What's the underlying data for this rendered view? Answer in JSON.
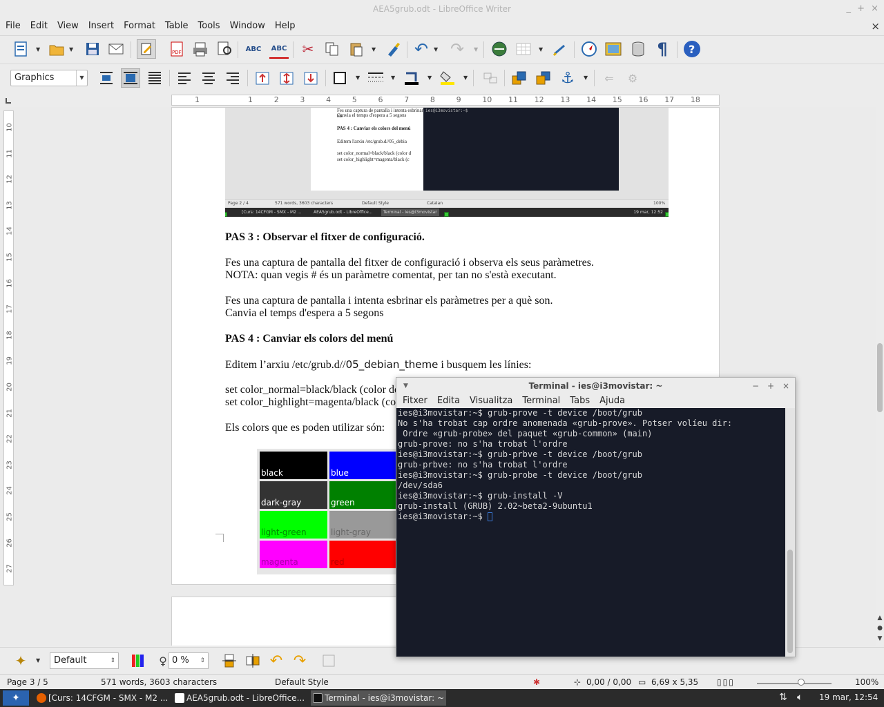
{
  "window": {
    "title": "AEA5grub.odt - LibreOffice Writer",
    "min": "_",
    "max": "+",
    "close": "×"
  },
  "menubar": {
    "items": [
      "File",
      "Edit",
      "View",
      "Insert",
      "Format",
      "Table",
      "Tools",
      "Window",
      "Help"
    ],
    "close_doc": "×"
  },
  "toolbar2": {
    "frame_style": "Graphics"
  },
  "ruler": {
    "h": [
      "1",
      "1",
      "2",
      "3",
      "4",
      "5",
      "6",
      "7",
      "8",
      "9",
      "10",
      "11",
      "12",
      "13",
      "14",
      "15",
      "16",
      "17",
      "18"
    ],
    "v": [
      "10",
      "11",
      "12",
      "13",
      "14",
      "15",
      "16",
      "17",
      "18",
      "19",
      "20",
      "21",
      "22",
      "23",
      "24",
      "25",
      "26",
      "27"
    ]
  },
  "embedded": {
    "doc_lines": [
      "Fes una captura de pantalla i intenta esbrinar els",
      "Canvia el temps d'espera a 5 segons",
      "PAS 4 : Canviar els colors del menú",
      "Editem l'arxiu /etc/grub.d//05_debia",
      "set color_normal=black/black (color d",
      "set color_highlight=magenta/black (c"
    ],
    "term_line": "ies@i3movistar:~$",
    "status": [
      "Page 2 / 4",
      "571 words, 3603 characters",
      "Default Style",
      "Catalan",
      "100%"
    ],
    "tasks": [
      "[Curs: 14CFGM - SMX - M2 ...",
      "AEA5grub.odt - LibreOffice...",
      "Terminal - ies@i3movistar"
    ],
    "clock": "19 mar, 12:52"
  },
  "document": {
    "h3": "PAS 3 : Observar el fitxer de configuració.",
    "p1a": "Fes una captura de pantalla del fitxer de configuració i observa els seus paràmetres.",
    "p1b": "NOTA: quan vegis # és un paràmetre comentat, per tan no s'està executant.",
    "p2a": "Fes una captura de pantalla i intenta esbrinar els paràmetres per a què son.",
    "p2b": "Canvia el temps d'espera a 5 segons",
    "h4": "PAS 4 : Canviar els colors del menú",
    "p3_pre": "Editem l’arxiu /etc/grub.d//",
    "p3_file": "05_debian_theme",
    "p3_post": " i busquem les línies:",
    "p4a": "set color_normal=black/black (color de",
    "p4b": "set color_highlight=magenta/black (co",
    "p5": "Els colors que es poden utilizar són:"
  },
  "colors": [
    {
      "name": "black",
      "bg": "#000000",
      "fg": "#ffffff"
    },
    {
      "name": "blue",
      "bg": "#0000ff",
      "fg": "#ffffff"
    },
    {
      "name": "dark-gray",
      "bg": "#333333",
      "fg": "#ffffff"
    },
    {
      "name": "green",
      "bg": "#008000",
      "fg": "#ffffff"
    },
    {
      "name": "light-green",
      "bg": "#00ff00",
      "fg": "#008800"
    },
    {
      "name": "light-gray",
      "bg": "#999999",
      "fg": "#666666"
    },
    {
      "name": "magenta",
      "bg": "#ff00ff",
      "fg": "#aa00aa"
    },
    {
      "name": "red",
      "bg": "#ff0000",
      "fg": "#bb0000"
    }
  ],
  "terminal": {
    "title": "Terminal - ies@i3movistar: ~",
    "menu": [
      "Fitxer",
      "Edita",
      "Visualitza",
      "Terminal",
      "Tabs",
      "Ajuda"
    ],
    "lines": [
      "ies@i3movistar:~$ grub-prove -t device /boot/grub",
      "No s'ha trobat cap ordre anomenada «grub-prove». Potser volíeu dir:",
      " Ordre «grub-probe» del paquet «grub-common» (main)",
      "grub-prove: no s'ha trobat l'ordre",
      "ies@i3movistar:~$ grub-prbve -t device /boot/grub",
      "grub-prbve: no s'ha trobat l'ordre",
      "ies@i3movistar:~$ grub-probe -t device /boot/grub",
      "/dev/sda6",
      "ies@i3movistar:~$ grub-install -V",
      "grub-install (GRUB) 2.02~beta2-9ubuntu1",
      "ies@i3movistar:~$ "
    ]
  },
  "bottom_toolbar": {
    "style": "Default",
    "transparency": "0 %"
  },
  "statusbar": {
    "page": "Page 3 / 5",
    "words": "571 words, 3603 characters",
    "style": "Default Style",
    "position": "0,00 / 0,00",
    "size": "6,69 x 5,35",
    "zoom": "100%"
  },
  "taskbar": {
    "tasks": [
      "[Curs: 14CFGM - SMX - M2 ...",
      "AEA5grub.odt - LibreOffice...",
      "Terminal - ies@i3movistar: ~"
    ],
    "clock": "19 mar, 12:54"
  }
}
